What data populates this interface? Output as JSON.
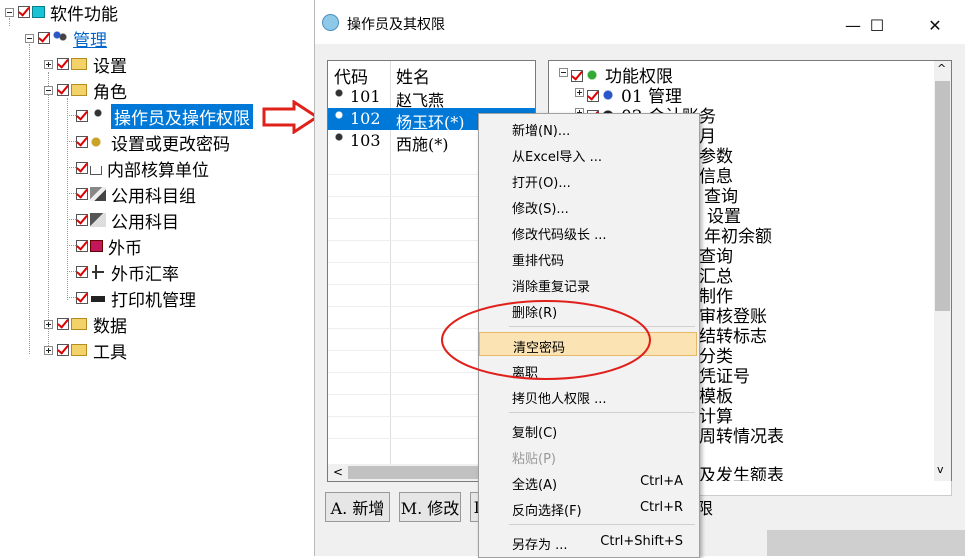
{
  "tree": {
    "root": "软件功能",
    "mgmt": "管理",
    "settings": "设置",
    "role": "角色",
    "operator_perm": "操作员及操作权限",
    "password": "设置或更改密码",
    "internal_unit": "内部核算单位",
    "subject_group": "公用科目组",
    "subject": "公用科目",
    "currency": "外币",
    "fx_rate": "外币汇率",
    "printer": "打印机管理",
    "data": "数据",
    "tools": "工具"
  },
  "dialog": {
    "title": "操作员及其权限",
    "minimize": "—",
    "maximize": "☐",
    "close": "✕"
  },
  "operators": {
    "headers": [
      "代码",
      "姓名"
    ],
    "rows": [
      {
        "code": "101",
        "name": "赵飞燕"
      },
      {
        "code": "102",
        "name": "杨玉环(*)"
      },
      {
        "code": "103",
        "name": "西施(*)"
      }
    ]
  },
  "permissions": {
    "title": "功能权限",
    "items": [
      "01 管理",
      "02 会计账务",
      "月",
      "参数",
      "信息",
      "查询",
      "设置",
      "年初余额",
      "查询",
      "汇总",
      "制作",
      "审核登账",
      "结转标志",
      "分类",
      "凭证号",
      "模板",
      "计算",
      "周转情况表",
      "及发生额表"
    ]
  },
  "buttons": {
    "add": "A. 新增",
    "modify": "M. 修改",
    "d": "D",
    "perm": "限"
  },
  "menu": {
    "items": [
      {
        "label": "新增(N)...",
        "shortcut": ""
      },
      {
        "label": "从Excel导入 ...",
        "shortcut": ""
      },
      {
        "label": "打开(O)...",
        "shortcut": ""
      },
      {
        "label": "修改(S)...",
        "shortcut": ""
      },
      {
        "label": "修改代码级长 ...",
        "shortcut": ""
      },
      {
        "label": "重排代码",
        "shortcut": ""
      },
      {
        "label": "消除重复记录",
        "shortcut": ""
      },
      {
        "label": "删除(R)",
        "shortcut": ""
      },
      {
        "label": "清空密码",
        "shortcut": ""
      },
      {
        "label": "离职",
        "shortcut": ""
      },
      {
        "label": "拷贝他人权限 ...",
        "shortcut": ""
      },
      {
        "label": "复制(C)",
        "shortcut": ""
      },
      {
        "label": "粘贴(P)",
        "shortcut": ""
      },
      {
        "label": "全选(A)",
        "shortcut": "Ctrl+A"
      },
      {
        "label": "反向选择(F)",
        "shortcut": "Ctrl+R"
      },
      {
        "label": "另存为 ...",
        "shortcut": "Ctrl+Shift+S"
      }
    ]
  },
  "colors": {
    "selection": "#0078d7",
    "highlight": "#fbe3b4",
    "annotation": "#e0201b"
  }
}
